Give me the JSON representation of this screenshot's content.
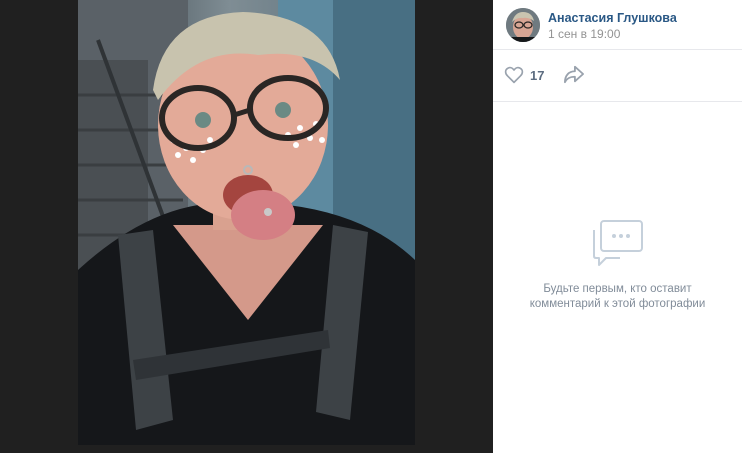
{
  "post": {
    "author_name": "Анастасия Глушкова",
    "date": "1 сен в 19:00",
    "likes": "17"
  },
  "comments": {
    "empty_line1": "Будьте первым, кто оставит",
    "empty_line2": "комментарий к этой фотографии"
  },
  "icons": {
    "like": "heart-icon",
    "share": "share-arrow-icon",
    "comments": "chat-bubble-icon"
  },
  "colors": {
    "link": "#2a5885",
    "muted": "#939393",
    "icon": "#99a2ad",
    "viewer_bg": "#202020"
  }
}
